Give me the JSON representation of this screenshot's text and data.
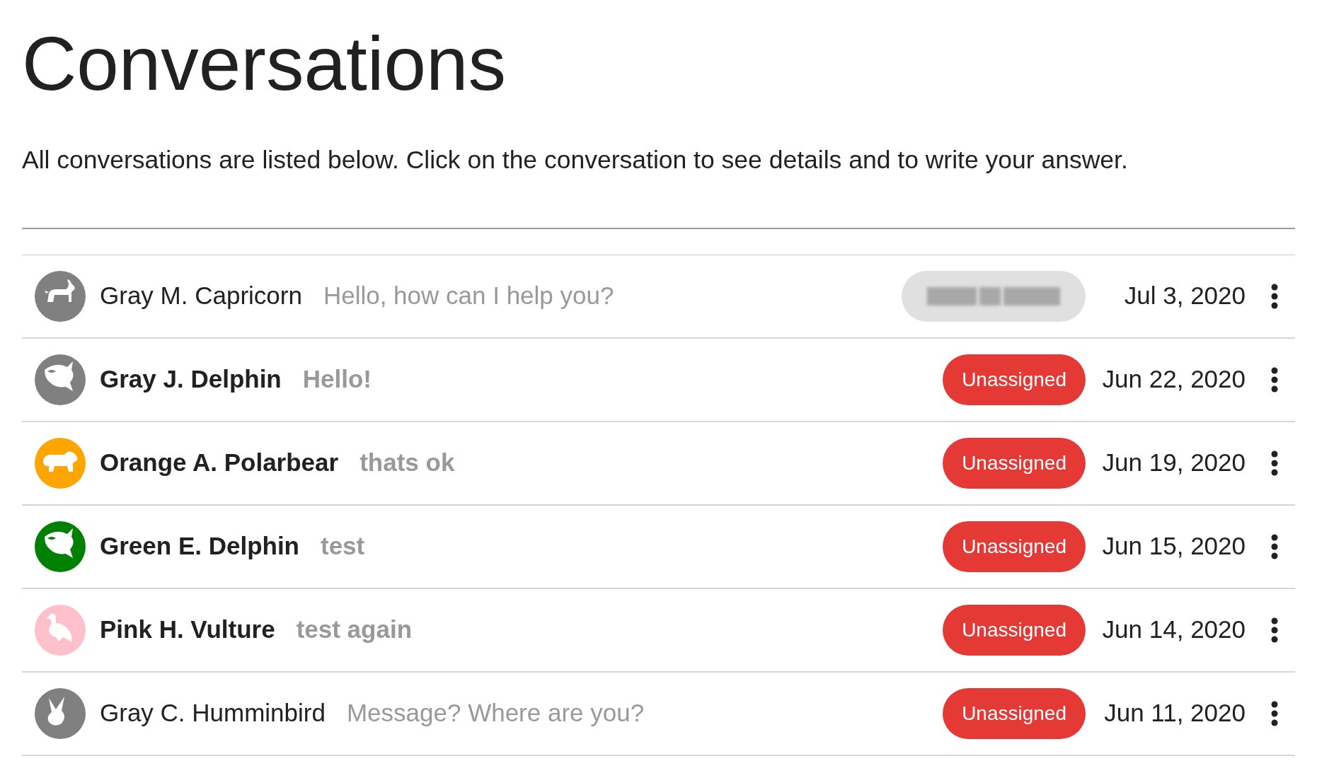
{
  "page": {
    "title": "Conversations",
    "description": "All conversations are listed below. Click on the conversation to see details and to write your answer."
  },
  "conversations": [
    {
      "name": "Gray M. Capricorn",
      "message": "Hello, how can I help you?",
      "unread": false,
      "avatar": {
        "kind": "goat",
        "color": "#808080"
      },
      "assignee": {
        "kind": "redacted"
      },
      "date": "Jul 3, 2020"
    },
    {
      "name": "Gray J. Delphin",
      "message": "Hello!",
      "unread": true,
      "avatar": {
        "kind": "orca",
        "color": "#808080"
      },
      "assignee": {
        "kind": "unassigned",
        "label": "Unassigned"
      },
      "date": "Jun 22, 2020"
    },
    {
      "name": "Orange A. Polarbear",
      "message": "thats ok",
      "unread": true,
      "avatar": {
        "kind": "bear",
        "color": "#ffa500"
      },
      "assignee": {
        "kind": "unassigned",
        "label": "Unassigned"
      },
      "date": "Jun 19, 2020"
    },
    {
      "name": "Green E. Delphin",
      "message": "test",
      "unread": true,
      "avatar": {
        "kind": "orca",
        "color": "#008000"
      },
      "assignee": {
        "kind": "unassigned",
        "label": "Unassigned"
      },
      "date": "Jun 15, 2020"
    },
    {
      "name": "Pink H. Vulture",
      "message": "test again",
      "unread": true,
      "avatar": {
        "kind": "vulture",
        "color": "#ffc0cb"
      },
      "assignee": {
        "kind": "unassigned",
        "label": "Unassigned"
      },
      "date": "Jun 14, 2020"
    },
    {
      "name": "Gray C. Humminbird",
      "message": "Message? Where are you?",
      "unread": false,
      "avatar": {
        "kind": "bird",
        "color": "#808080"
      },
      "assignee": {
        "kind": "unassigned",
        "label": "Unassigned"
      },
      "date": "Jun 11, 2020"
    }
  ]
}
